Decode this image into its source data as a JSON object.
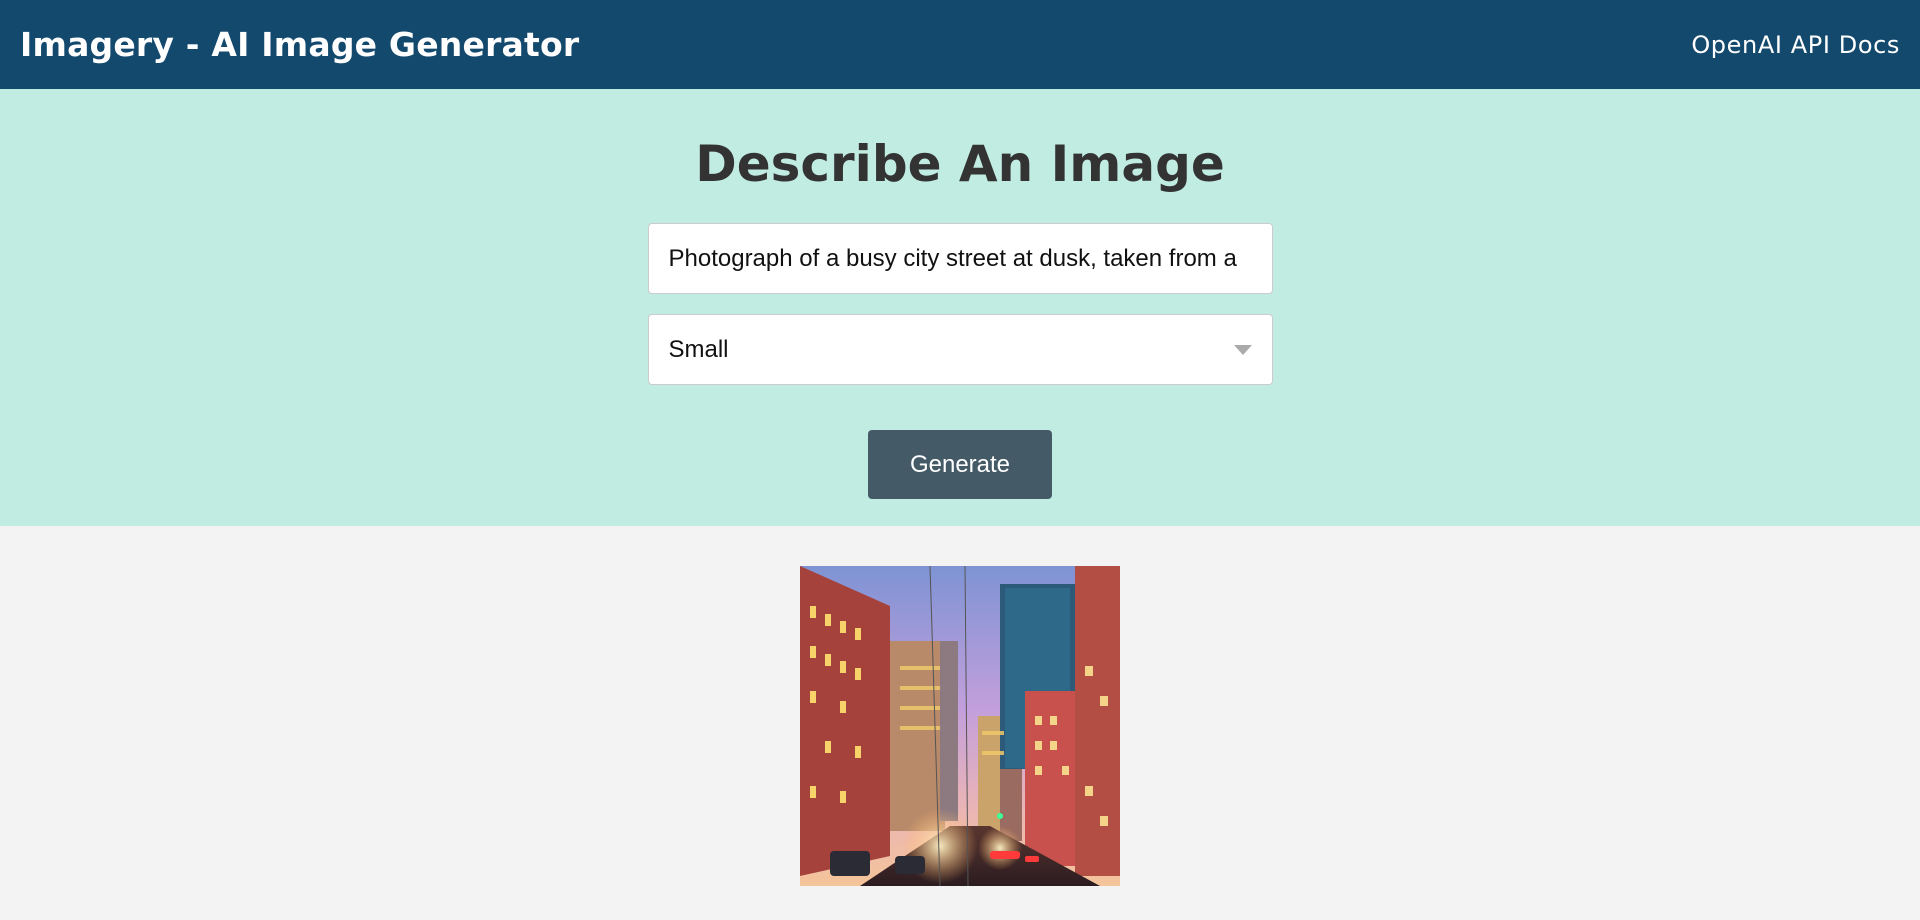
{
  "navbar": {
    "brand": "Imagery - AI Image Generator",
    "docs_link": "OpenAI API Docs",
    "background": "#14496e"
  },
  "showcase": {
    "title": "Describe An Image",
    "background": "#c1ece2",
    "prompt_value": "Photograph of a busy city street at dusk, taken from a",
    "size_select": {
      "selected": "Small",
      "icon": "chevron-down-icon"
    },
    "generate_label": "Generate",
    "button_color": "#455a67"
  },
  "result": {
    "image_subject": "generated-city-street-image"
  }
}
